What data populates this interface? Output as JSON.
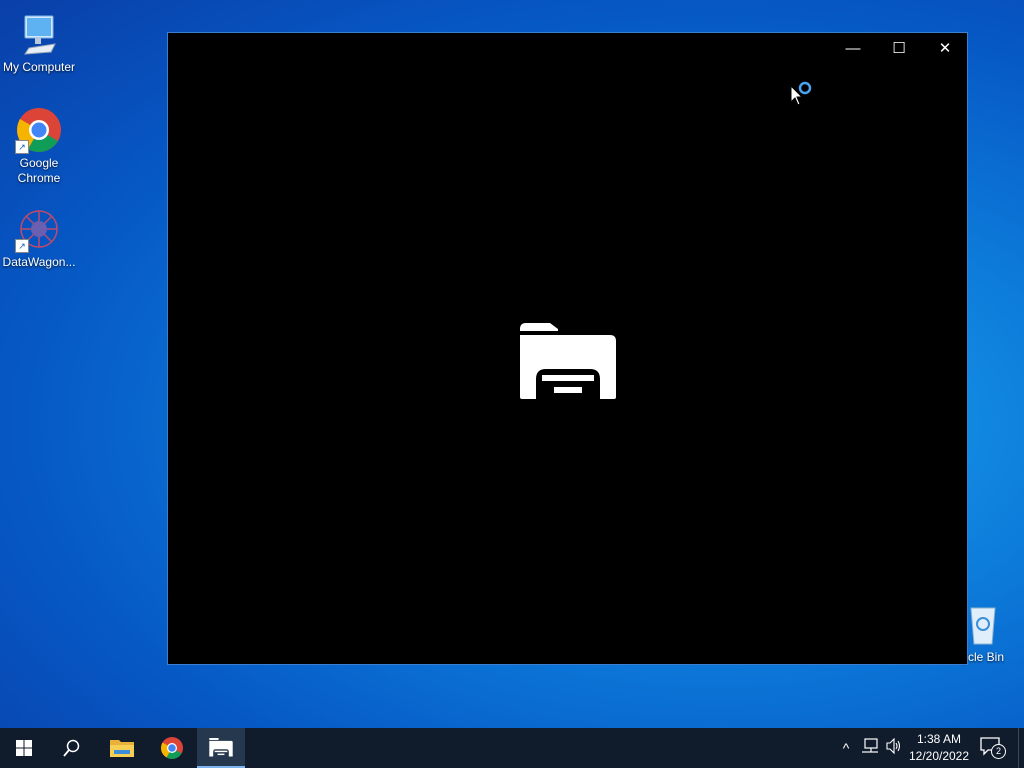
{
  "desktop": {
    "icons": [
      {
        "label": "My Computer",
        "icon": "monitor-icon"
      },
      {
        "label": "Google Chrome",
        "icon": "chrome-icon"
      },
      {
        "label": "DataWagon...",
        "icon": "datawagon-icon"
      },
      {
        "label": "ycle Bin",
        "icon": "recycle-bin-icon"
      }
    ]
  },
  "window": {
    "controls": {
      "minimize": "—",
      "maximize": "☐",
      "close": "✕"
    },
    "splash_icon": "file-explorer-icon"
  },
  "taskbar": {
    "items": [
      "start-icon",
      "search-icon",
      "file-explorer-icon",
      "chrome-icon",
      "file-explorer-window-icon"
    ],
    "tray": {
      "chevron": "^",
      "time": "1:38 AM",
      "date": "12/20/2022",
      "notification_count": "2"
    }
  },
  "colors": {
    "accent": "#0078d7",
    "taskbar": "#101b2b",
    "window_bg": "#000000"
  }
}
